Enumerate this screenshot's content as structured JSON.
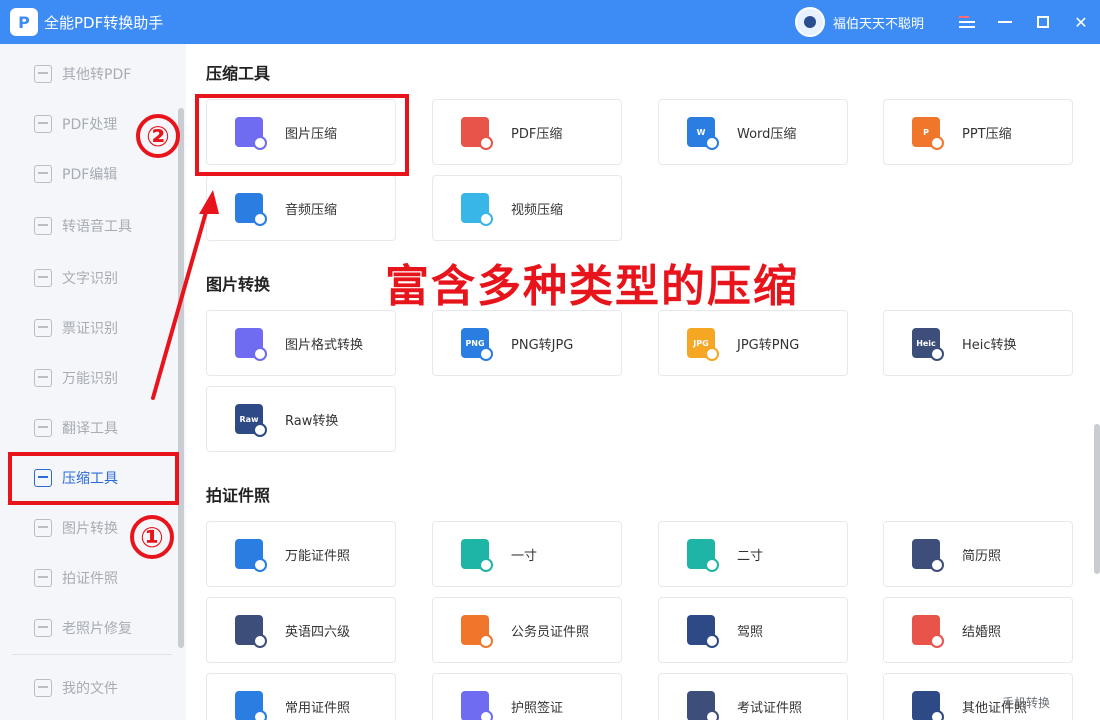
{
  "app": {
    "title": "全能PDF转换助手",
    "logo_letter": "P",
    "username": "福伯天天不聪明"
  },
  "sidebar": {
    "items": [
      {
        "label": "其他转PDF"
      },
      {
        "label": "PDF处理"
      },
      {
        "label": "PDF编辑"
      },
      {
        "label": "转语音工具"
      },
      {
        "label": "文字识别"
      },
      {
        "label": "票证识别"
      },
      {
        "label": "万能识别"
      },
      {
        "label": "翻译工具"
      },
      {
        "label": "压缩工具",
        "active": true
      },
      {
        "label": "图片转换"
      },
      {
        "label": "拍证件照"
      },
      {
        "label": "老照片修复"
      }
    ],
    "bottom_item": "我的文件"
  },
  "sections": [
    {
      "title": "压缩工具",
      "cards": [
        {
          "label": "图片压缩",
          "icon": "image-compress-icon",
          "color": "#6f6cf2",
          "badge": ""
        },
        {
          "label": "PDF压缩",
          "icon": "pdf-compress-icon",
          "color": "#e8534a",
          "badge": ""
        },
        {
          "label": "Word压缩",
          "icon": "word-compress-icon",
          "color": "#2a7de1",
          "badge": "W"
        },
        {
          "label": "PPT压缩",
          "icon": "ppt-compress-icon",
          "color": "#f0762c",
          "badge": "P"
        },
        {
          "label": "音频压缩",
          "icon": "audio-compress-icon",
          "color": "#2a7de1",
          "badge": ""
        },
        {
          "label": "视频压缩",
          "icon": "video-compress-icon",
          "color": "#38b6e8",
          "badge": ""
        }
      ]
    },
    {
      "title": "图片转换",
      "cards": [
        {
          "label": "图片格式转换",
          "icon": "image-format-icon",
          "color": "#6f6cf2",
          "badge": ""
        },
        {
          "label": "PNG转JPG",
          "icon": "png-icon",
          "color": "#2a7de1",
          "badge": "PNG"
        },
        {
          "label": "JPG转PNG",
          "icon": "jpg-icon",
          "color": "#f5a623",
          "badge": "JPG"
        },
        {
          "label": "Heic转换",
          "icon": "heic-icon",
          "color": "#3d4e7a",
          "badge": "Heic"
        },
        {
          "label": "Raw转换",
          "icon": "raw-icon",
          "color": "#2e4a86",
          "badge": "Raw"
        }
      ]
    },
    {
      "title": "拍证件照",
      "cards": [
        {
          "label": "万能证件照",
          "icon": "universal-id-photo-icon",
          "color": "#2a7de1",
          "badge": ""
        },
        {
          "label": "一寸",
          "icon": "one-inch-icon",
          "color": "#1fb5a6",
          "badge": ""
        },
        {
          "label": "二寸",
          "icon": "two-inch-icon",
          "color": "#1fb5a6",
          "badge": ""
        },
        {
          "label": "简历照",
          "icon": "resume-photo-icon",
          "color": "#3d4e7a",
          "badge": ""
        },
        {
          "label": "英语四六级",
          "icon": "cet-photo-icon",
          "color": "#3d4e7a",
          "badge": ""
        },
        {
          "label": "公务员证件照",
          "icon": "civil-servant-photo-icon",
          "color": "#f0762c",
          "badge": ""
        },
        {
          "label": "驾照",
          "icon": "driver-license-icon",
          "color": "#2e4a86",
          "badge": ""
        },
        {
          "label": "结婚照",
          "icon": "marriage-photo-icon",
          "color": "#e8534a",
          "badge": ""
        },
        {
          "label": "常用证件照",
          "icon": "common-id-photo-icon",
          "color": "#2a7de1",
          "badge": ""
        },
        {
          "label": "护照签证",
          "icon": "passport-visa-icon",
          "color": "#6f6cf2",
          "badge": ""
        },
        {
          "label": "考试证件照",
          "icon": "exam-photo-icon",
          "color": "#3d4e7a",
          "badge": ""
        },
        {
          "label": "其他证件照",
          "icon": "other-id-photo-icon",
          "color": "#2e4a86",
          "badge": ""
        }
      ]
    }
  ],
  "annotations": {
    "step1": "①",
    "step2": "②",
    "headline": "富含多种类型的压缩",
    "accent_color": "#e8141c"
  },
  "watermark": "手机转换"
}
